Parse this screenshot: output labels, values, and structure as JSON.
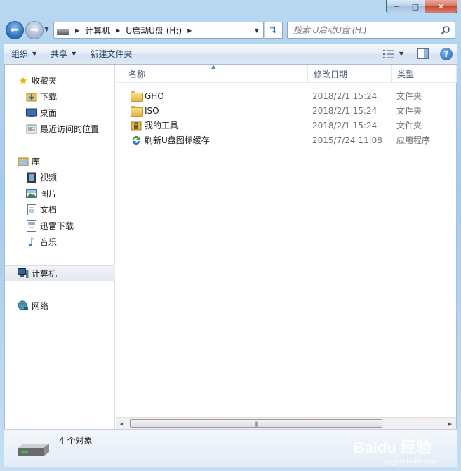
{
  "window": {
    "caption_min": "─",
    "caption_max": "□",
    "caption_close": "✕"
  },
  "address": {
    "crumbs": [
      "计算机",
      "U启动U盘 (H:)"
    ]
  },
  "search": {
    "placeholder": "搜索 U启动U盘 (H:)"
  },
  "toolbar": {
    "organize": "组织",
    "share": "共享",
    "new_folder": "新建文件夹",
    "help": "?"
  },
  "sidebar": {
    "favorites": {
      "label": "收藏夹",
      "items": [
        {
          "label": "下载",
          "icon": "download-folder-icon"
        },
        {
          "label": "桌面",
          "icon": "desktop-icon"
        },
        {
          "label": "最近访问的位置",
          "icon": "recent-places-icon"
        }
      ]
    },
    "libraries": {
      "label": "库",
      "items": [
        {
          "label": "视频",
          "icon": "video-library-icon"
        },
        {
          "label": "图片",
          "icon": "pictures-library-icon"
        },
        {
          "label": "文档",
          "icon": "documents-library-icon"
        },
        {
          "label": "迅雷下载",
          "icon": "xunlei-download-icon"
        },
        {
          "label": "音乐",
          "icon": "music-library-icon"
        }
      ]
    },
    "computer": {
      "label": "计算机"
    },
    "network": {
      "label": "网络"
    }
  },
  "columns": {
    "name": "名称",
    "date": "修改日期",
    "type": "类型"
  },
  "files": [
    {
      "name": "GHO",
      "date": "2018/2/1 15:24",
      "type": "文件夹",
      "icon": "folder-icon"
    },
    {
      "name": "ISO",
      "date": "2018/2/1 15:24",
      "type": "文件夹",
      "icon": "folder-icon"
    },
    {
      "name": "我的工具",
      "date": "2018/2/1 15:24",
      "type": "文件夹",
      "icon": "locked-folder-icon"
    },
    {
      "name": "刷新U盘图标缓存",
      "date": "2015/7/24 11:08",
      "type": "应用程序",
      "icon": "refresh-app-icon"
    }
  ],
  "status": {
    "count": "4 个对象"
  },
  "watermark": {
    "brand": "Baidu 经验",
    "url": "jingyan.baidu.com"
  }
}
